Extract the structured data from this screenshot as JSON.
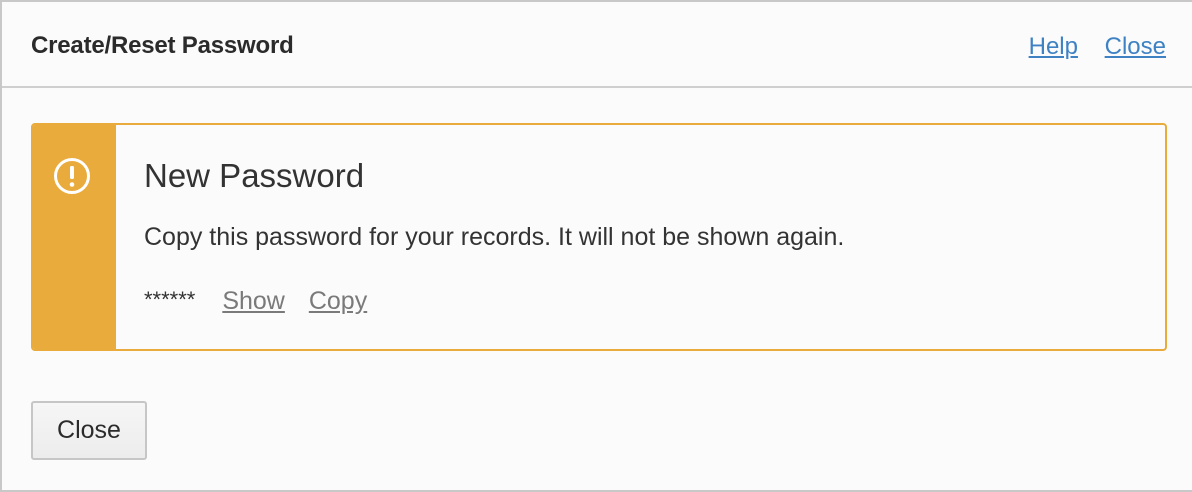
{
  "dialog": {
    "title": "Create/Reset Password",
    "help_link": "Help",
    "close_link": "Close"
  },
  "alert": {
    "icon": "exclamation-circle-icon",
    "accent_color": "#e9ab3c",
    "heading": "New Password",
    "message": "Copy this password for your records. It will not be shown again.",
    "masked_password": "******",
    "show_link": "Show",
    "copy_link": "Copy"
  },
  "footer": {
    "close_button": "Close"
  },
  "colors": {
    "link": "#3f82c4",
    "muted_link": "#7a7a7a",
    "warning": "#e9ab3c"
  }
}
